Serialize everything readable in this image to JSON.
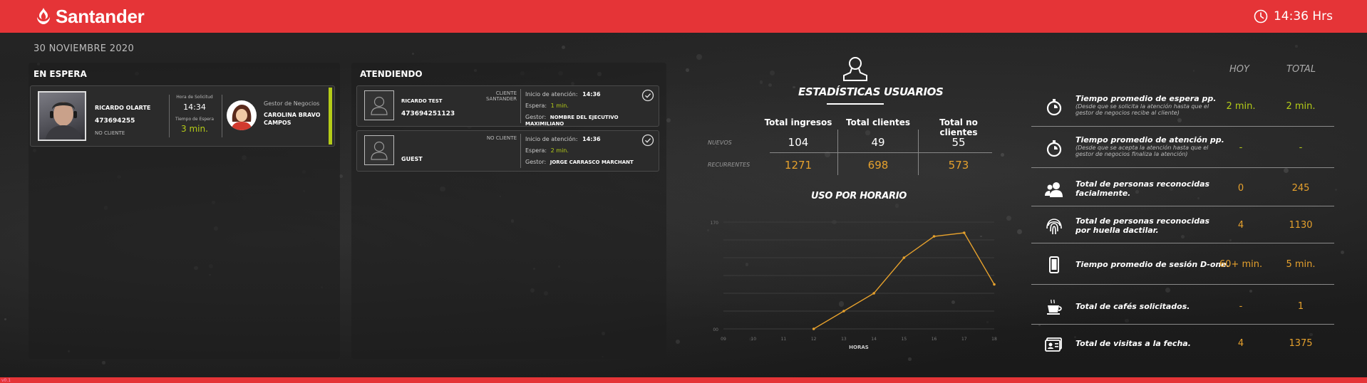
{
  "brand": {
    "name": "Santander"
  },
  "clock": {
    "time": "14:36 Hrs"
  },
  "date": "30 NOVIEMBRE 2020",
  "waiting": {
    "title": "EN ESPERA",
    "card": {
      "name": "RICARDO OLARTE",
      "id": "473694255",
      "client_status": "NO CLIENTE",
      "request_label": "Hora de Solicitud",
      "request_time": "14:34",
      "wait_label": "Tiempo de Espera",
      "wait_time": "3 min.",
      "manager_role": "Gestor de Negocios",
      "manager_name_1": "CAROLINA BRAVO",
      "manager_name_2": "CAMPOS"
    }
  },
  "attending": {
    "title": "ATENDIENDO",
    "cards": [
      {
        "name": "RICARDO TEST",
        "id": "473694251123",
        "client_type_1": "CLIENTE",
        "client_type_2": "SANTANDER",
        "start_label": "Inicio de atención:",
        "start_time": "14:36",
        "wait_label": "Espera:",
        "wait_value": "1 min.",
        "manager_label": "Gestor:",
        "manager_value": "NOMBRE DEL EJECUTIVO  MAXIMILIANO"
      },
      {
        "name": "GUEST",
        "id": "",
        "client_type_1": "NO CLIENTE",
        "client_type_2": "",
        "start_label": "Inicio de atención:",
        "start_time": "14:36",
        "wait_label": "Espera:",
        "wait_value": "2 min.",
        "manager_label": "Gestor:",
        "manager_value": "JORGE CARRASCO MARCHANT"
      }
    ]
  },
  "stats": {
    "title": "ESTADÍSTICAS USUARIOS",
    "headers": [
      "Total ingresos",
      "Total clientes",
      "Total no clientes"
    ],
    "rows": [
      {
        "label": "NUEVOS",
        "values": [
          "104",
          "49",
          "55"
        ]
      },
      {
        "label": "RECURRENTES",
        "values": [
          "1271",
          "698",
          "573"
        ]
      }
    ]
  },
  "usage_chart": {
    "title": "USO POR HORARIO"
  },
  "chart_data": {
    "type": "line",
    "title": "USO POR HORARIO",
    "xlabel": "HORAS",
    "ylabel": "",
    "categories": [
      "09",
      "10",
      "11",
      "12",
      "13",
      "14",
      "15",
      "16",
      "17",
      "18"
    ],
    "series": [
      {
        "values": [
          null,
          null,
          null,
          0,
          10,
          20,
          40,
          52,
          54,
          25
        ]
      }
    ],
    "ylim": [
      0,
      60
    ],
    "y_tick_labels": [
      "00",
      "170"
    ],
    "grid": true,
    "line_color": "#e6a12d"
  },
  "metrics": {
    "col_today": "HOY",
    "col_total": "TOTAL",
    "rows": [
      {
        "icon": "stopwatch-icon",
        "label": "Tiempo promedio de espera pp.",
        "sub_1": "(Desde que se solicita la atención hasta que el",
        "sub_2": "gestor de negocios recibe al cliente)",
        "label_2": "",
        "today": "2 min.",
        "total": "2 min.",
        "color": "#b5cc18"
      },
      {
        "icon": "stopwatch-icon",
        "label": "Tiempo promedio de atención pp.",
        "sub_1": "(Desde que se acepta la atención hasta que el",
        "sub_2": "gestor de negocios finaliza la atención)",
        "label_2": "",
        "today": "-",
        "total": "-",
        "color": "#b5cc18"
      },
      {
        "icon": "users-icon",
        "label": "Total de personas reconocidas",
        "sub_1": "",
        "sub_2": "",
        "label_2": "facialmente.",
        "today": "0",
        "total": "245",
        "color": "#e6a12d"
      },
      {
        "icon": "fingerprint-icon",
        "label": "Total de personas reconocidas",
        "sub_1": "",
        "sub_2": "",
        "label_2": "por huella dactilar.",
        "today": "4",
        "total": "1130",
        "color": "#e6a12d"
      },
      {
        "icon": "tablet-icon",
        "label": "Tiempo promedio de sesión D-one.",
        "sub_1": "",
        "sub_2": "",
        "label_2": "",
        "today": "60+ min.",
        "total": "5 min.",
        "color": "#e6a12d"
      },
      {
        "icon": "coffee-icon",
        "label": "Total de cafés solicitados.",
        "sub_1": "",
        "sub_2": "",
        "label_2": "",
        "today": "-",
        "total": "1",
        "color": "#e6a12d"
      },
      {
        "icon": "id-card-icon",
        "label": "Total de visitas a la fecha.",
        "sub_1": "",
        "sub_2": "",
        "label_2": "",
        "today": "4",
        "total": "1375",
        "color": "#e6a12d"
      }
    ]
  },
  "version": "v0.1"
}
